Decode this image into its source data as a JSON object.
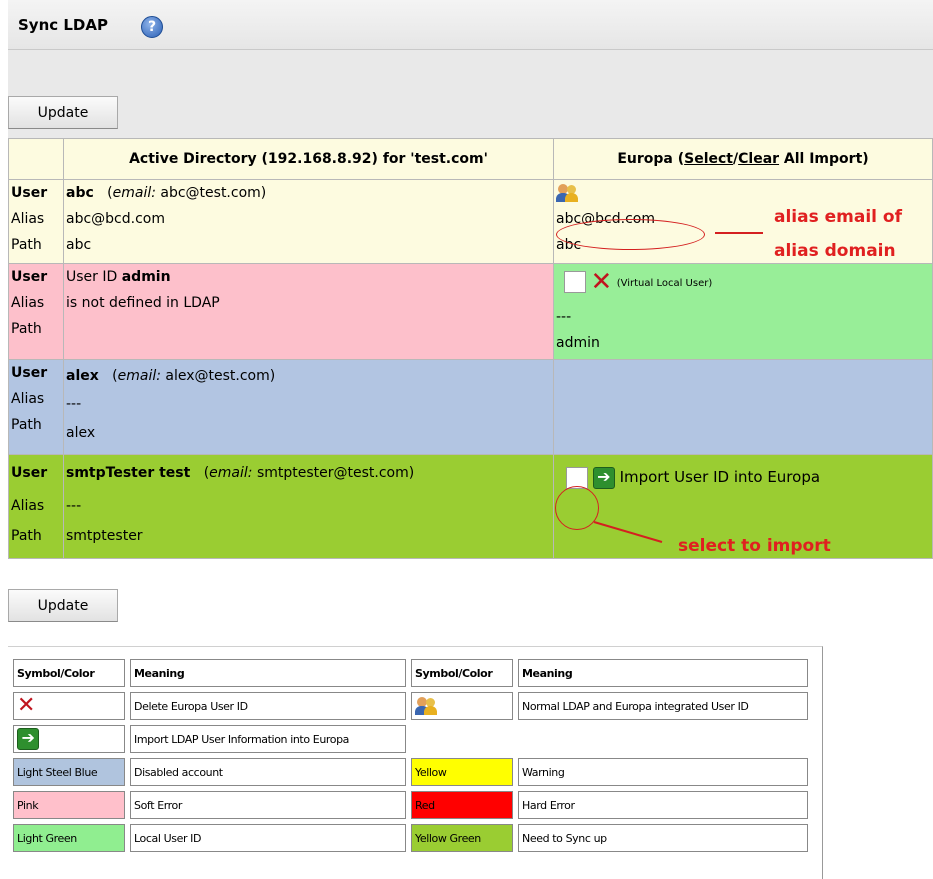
{
  "header": {
    "title": "Sync LDAP",
    "help_icon": "?"
  },
  "buttons": {
    "update_top": "Update",
    "update_bottom": "Update"
  },
  "table": {
    "col_ad": "Active Directory (192.168.8.92) for 'test.com'",
    "col_europa_prefix": "Europa (",
    "col_europa_select": "Select",
    "col_europa_sep": "/",
    "col_europa_clear": "Clear",
    "col_europa_suffix": " All Import)",
    "rows": [
      {
        "user_label": "User",
        "alias_label": "Alias",
        "path_label": "Path",
        "name": "abc",
        "email_prefix": "email:",
        "email": " abc@test.com)",
        "email_open": "(",
        "alias": "abc@bcd.com",
        "path": "abc",
        "right_alias": "abc@bcd.com",
        "right_path": "abc"
      },
      {
        "user_label": "User",
        "alias_label": "Alias",
        "path_label": "Path",
        "name_prefix": "User ID ",
        "name": "admin",
        "alias": "is not defined in LDAP",
        "path": "",
        "right_note": "(Virtual Local User)",
        "right_alias": "---",
        "right_path": "admin"
      },
      {
        "user_label": "User",
        "alias_label": "Alias",
        "path_label": "Path",
        "name": "alex",
        "email_open": "(",
        "email_prefix": "email:",
        "email": " alex@test.com)",
        "alias": "---",
        "path": "alex"
      },
      {
        "user_label": "User",
        "alias_label": "Alias",
        "path_label": "Path",
        "name": "smtpTester test",
        "email_open": "(",
        "email_prefix": "email:",
        "email": " smtptester@test.com)",
        "alias": "---",
        "path": "smtptester",
        "right_import": "Import User ID into Europa"
      }
    ]
  },
  "annotations": {
    "alias_line1": "alias email of",
    "alias_line2": "alias domain",
    "select": "select to import"
  },
  "legend": {
    "h_symbol": "Symbol/Color",
    "h_meaning": "Meaning",
    "delete": "Delete Europa User ID",
    "normal": "Normal LDAP and Europa integrated User ID",
    "import": "Import LDAP User Information into Europa",
    "lsb_name": "Light Steel Blue",
    "lsb_meaning": "Disabled account",
    "yellow_name": "Yellow",
    "yellow_meaning": "Warning",
    "pink_name": "Pink",
    "pink_meaning": "Soft Error",
    "red_name": "Red",
    "red_meaning": "Hard Error",
    "lg_name": "Light Green",
    "lg_meaning": "Local User ID",
    "yg_name": "Yellow Green",
    "yg_meaning": "Need to Sync up",
    "colors": {
      "light_steel_blue": "#b0c4de",
      "yellow": "#ffff00",
      "pink": "#ffc0cb",
      "red": "#ff0000",
      "light_green": "#90ee90",
      "yellow_green": "#9acd32"
    }
  }
}
